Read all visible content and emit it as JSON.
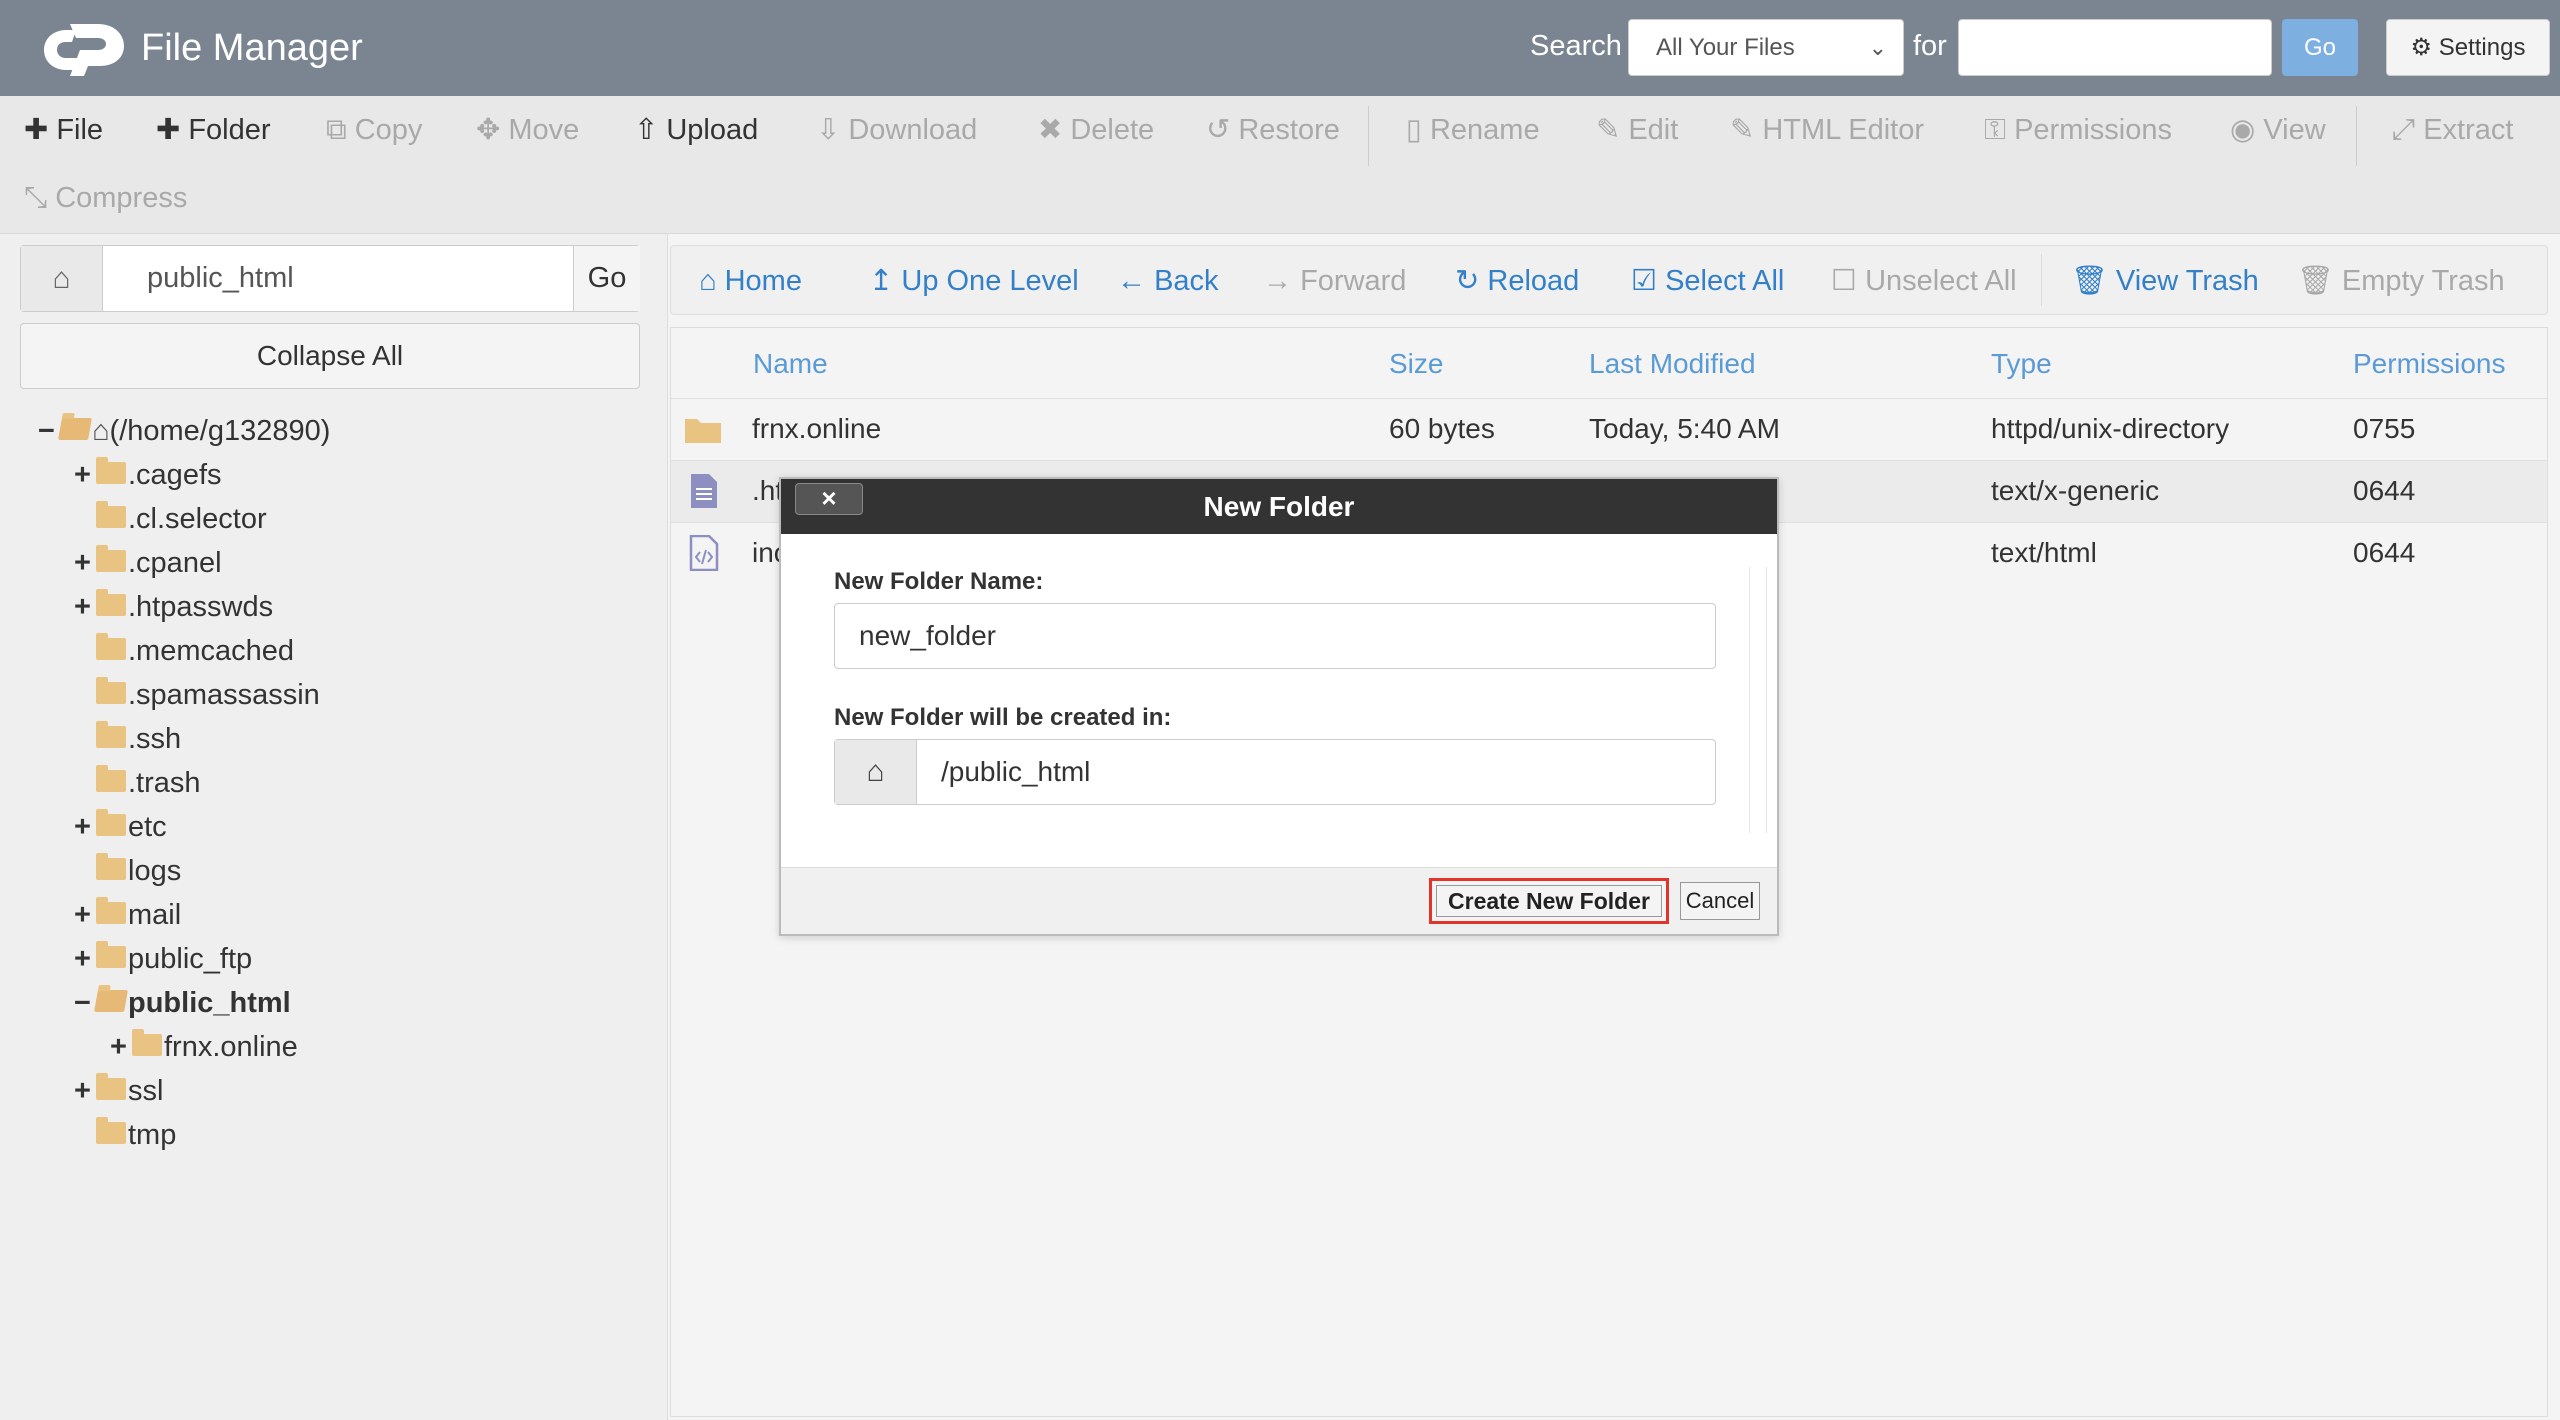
{
  "header": {
    "title": "File Manager",
    "search_label": "Search",
    "search_scope": "All Your Files",
    "for_label": "for",
    "search_value": "",
    "go_label": "Go",
    "settings_label": "Settings"
  },
  "toolbar": {
    "file": "File",
    "folder": "Folder",
    "copy": "Copy",
    "move": "Move",
    "upload": "Upload",
    "download": "Download",
    "delete": "Delete",
    "restore": "Restore",
    "rename": "Rename",
    "edit": "Edit",
    "html_editor": "HTML Editor",
    "permissions": "Permissions",
    "view": "View",
    "extract": "Extract",
    "compress": "Compress"
  },
  "left": {
    "path_value": "public_html",
    "go_label": "Go",
    "collapse_label": "Collapse All",
    "tree": [
      {
        "label": "(/home/g132890)"
      },
      {
        "label": ".cagefs"
      },
      {
        "label": ".cl.selector"
      },
      {
        "label": ".cpanel"
      },
      {
        "label": ".htpasswds"
      },
      {
        "label": ".memcached"
      },
      {
        "label": ".spamassassin"
      },
      {
        "label": ".ssh"
      },
      {
        "label": ".trash"
      },
      {
        "label": "etc"
      },
      {
        "label": "logs"
      },
      {
        "label": "mail"
      },
      {
        "label": "public_ftp"
      },
      {
        "label": "public_html"
      },
      {
        "label": "frnx.online"
      },
      {
        "label": "ssl"
      },
      {
        "label": "tmp"
      }
    ]
  },
  "nav": {
    "home": "Home",
    "up": "Up One Level",
    "back": "Back",
    "forward": "Forward",
    "reload": "Reload",
    "select_all": "Select All",
    "unselect_all": "Unselect All",
    "view_trash": "View Trash",
    "empty_trash": "Empty Trash"
  },
  "table": {
    "headers": {
      "name": "Name",
      "size": "Size",
      "modified": "Last Modified",
      "type": "Type",
      "perms": "Permissions"
    },
    "rows": [
      {
        "name": "frnx.online",
        "size": "60 bytes",
        "modified": "Today, 5:40 AM",
        "type": "httpd/unix-directory",
        "perms": "0755"
      },
      {
        "name": ".ht",
        "size": "",
        "modified": "",
        "type": "text/x-generic",
        "perms": "0644"
      },
      {
        "name": "inc",
        "size": "",
        "modified": "",
        "type": "text/html",
        "perms": "0644"
      }
    ]
  },
  "dialog": {
    "title": "New Folder",
    "close_label": "×",
    "name_label": "New Folder Name:",
    "name_value": "new_folder",
    "location_label": "New Folder will be created in:",
    "location_value": "/public_html",
    "create_label": "Create New Folder",
    "cancel_label": "Cancel"
  }
}
